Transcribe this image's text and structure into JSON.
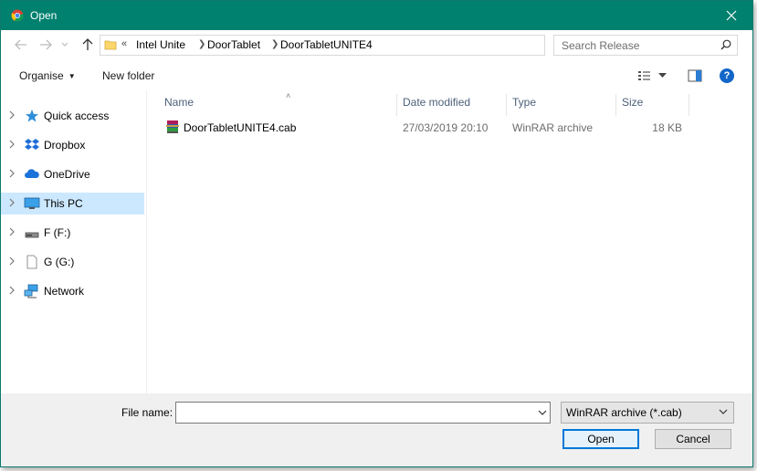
{
  "window": {
    "title": "Open"
  },
  "address": {
    "overflow": "«",
    "crumbs": [
      "Intel Unite",
      "DoorTablet",
      "DoorTabletUNITE4"
    ]
  },
  "search": {
    "placeholder": "Search Release"
  },
  "toolbar": {
    "organise": "Organise",
    "new_folder": "New folder",
    "help": "?"
  },
  "sidebar": {
    "items": [
      {
        "label": "Quick access",
        "icon": "star-icon"
      },
      {
        "label": "Dropbox",
        "icon": "dropbox-icon"
      },
      {
        "label": "OneDrive",
        "icon": "onedrive-icon"
      },
      {
        "label": "This PC",
        "icon": "pc-icon"
      },
      {
        "label": "F (F:)",
        "icon": "drive-icon"
      },
      {
        "label": "G (G:)",
        "icon": "document-icon"
      },
      {
        "label": "Network",
        "icon": "network-icon"
      }
    ]
  },
  "columns": {
    "name": "Name",
    "date": "Date modified",
    "type": "Type",
    "size": "Size"
  },
  "files": [
    {
      "name": "DoorTabletUNITE4.cab",
      "date": "27/03/2019 20:10",
      "type": "WinRAR archive",
      "size": "18 KB"
    }
  ],
  "bottom": {
    "file_name_label": "File name:",
    "file_name_value": "",
    "filter": "WinRAR archive (*.cab)",
    "open": "Open",
    "cancel": "Cancel"
  },
  "colors": {
    "titlebar": "#00806e",
    "selected": "#cce8ff",
    "accent": "#0078d7"
  }
}
